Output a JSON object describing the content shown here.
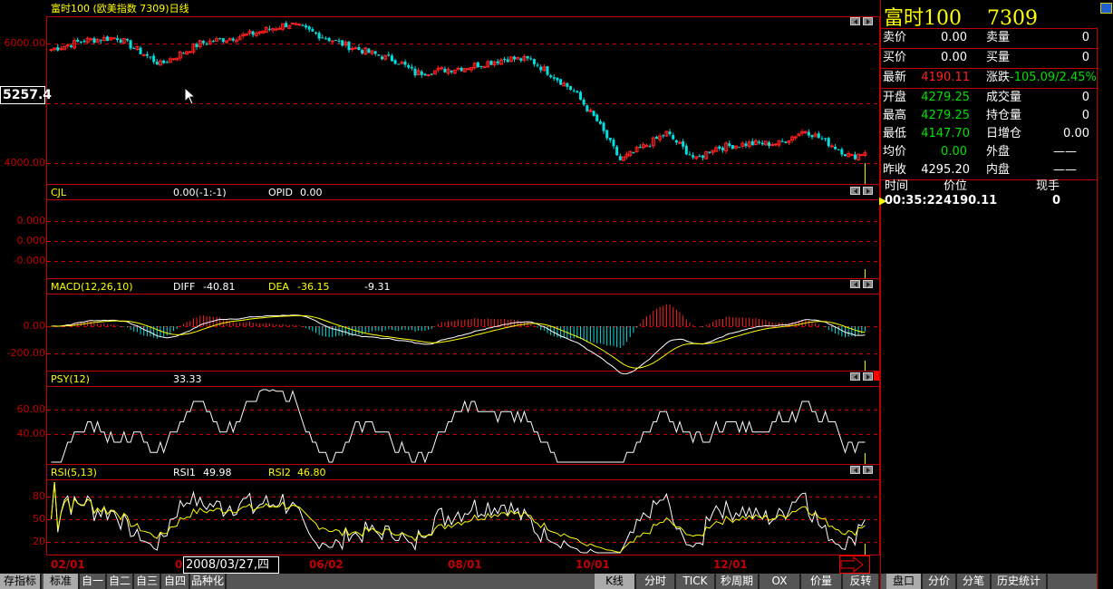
{
  "title": "富时100  (欧美指数 7309)日线",
  "cursor_price": "5257.4",
  "main": {
    "ticks": [
      "6000.00",
      "4000.00"
    ]
  },
  "cjl": {
    "name": "CJL",
    "v1": "0.00(-1:-1)",
    "v2_label": "OPID",
    "v2": "0.00",
    "ticks": [
      "0.000",
      "0.000",
      "-0.000"
    ]
  },
  "macd": {
    "name": "MACD(12,26,10)",
    "diff_label": "DIFF",
    "diff": "-40.81",
    "dea_label": "DEA",
    "dea": "-36.15",
    "macd": "-9.31",
    "ticks": [
      "0.00",
      "-200.00"
    ]
  },
  "psy": {
    "name": "PSY(12)",
    "value": "33.33",
    "ticks": [
      "60.00",
      "40.00"
    ]
  },
  "rsi": {
    "name": "RSI(5,13)",
    "rsi1_label": "RSI1",
    "rsi1": "49.98",
    "rsi2_label": "RSI2",
    "rsi2": "46.80",
    "ticks": [
      "80",
      "50",
      "20"
    ]
  },
  "dates": [
    "02/01",
    "0",
    "06/02",
    "08/01",
    "10/01",
    "12/01"
  ],
  "date_box": "2008/03/27,四",
  "quote": {
    "title": "富时100    7309",
    "sell_price_label": "卖价",
    "sell_price": "0.00",
    "sell_vol_label": "卖量",
    "sell_vol": "0",
    "buy_price_label": "买价",
    "buy_price": "0.00",
    "buy_vol_label": "买量",
    "buy_vol": "0",
    "last_label": "最新",
    "last": "4190.11",
    "change_label": "涨跌",
    "change": "-105.09/2.45%",
    "open_label": "开盘",
    "open": "4279.25",
    "volume_label": "成交量",
    "volume": "0",
    "high_label": "最高",
    "high": "4279.25",
    "oi_label": "持仓量",
    "oi": "0",
    "low_label": "最低",
    "low": "4147.70",
    "oi_chg_label": "日增仓",
    "oi_chg": "0.00",
    "avg_label": "均价",
    "avg": "0.00",
    "outer_label": "外盘",
    "outer": "——",
    "prev_label": "昨收",
    "prev": "4295.20",
    "inner_label": "内盘",
    "inner": "——",
    "ticks_header": [
      "时间",
      "价位",
      "现手"
    ],
    "ticks": [
      {
        "time": "00:35:22",
        "price": "4190.11",
        "vol": "0"
      }
    ]
  },
  "toolbar_left": [
    "存指标",
    "标准",
    "自一",
    "自二",
    "自三",
    "自四",
    "品种化"
  ],
  "toolbar_mid": [
    "K线",
    "分时",
    "TICK",
    "秒周期",
    "OX",
    "价量",
    "反转"
  ],
  "toolbar_right": [
    "盘口",
    "分价",
    "分笔",
    "历史统计"
  ],
  "colors": {
    "up": "#ff2020",
    "down": "#00e0e0",
    "grid": "#c00000",
    "label": "#ffff00"
  },
  "chart_data": {
    "type": "candlestick",
    "anchors": [
      [
        0,
        5900
      ],
      [
        10,
        6050
      ],
      [
        20,
        6100
      ],
      [
        33,
        5650
      ],
      [
        45,
        6000
      ],
      [
        60,
        6150
      ],
      [
        72,
        6330
      ],
      [
        90,
        5950
      ],
      [
        105,
        5700
      ],
      [
        110,
        5500
      ],
      [
        125,
        5600
      ],
      [
        138,
        5750
      ],
      [
        145,
        5720
      ],
      [
        152,
        5450
      ],
      [
        158,
        5200
      ],
      [
        165,
        4700
      ],
      [
        172,
        4050
      ],
      [
        180,
        4300
      ],
      [
        186,
        4500
      ],
      [
        195,
        4050
      ],
      [
        200,
        4250
      ],
      [
        210,
        4320
      ],
      [
        220,
        4330
      ],
      [
        228,
        4550
      ],
      [
        236,
        4300
      ],
      [
        242,
        4100
      ],
      [
        246,
        4190
      ]
    ]
  }
}
